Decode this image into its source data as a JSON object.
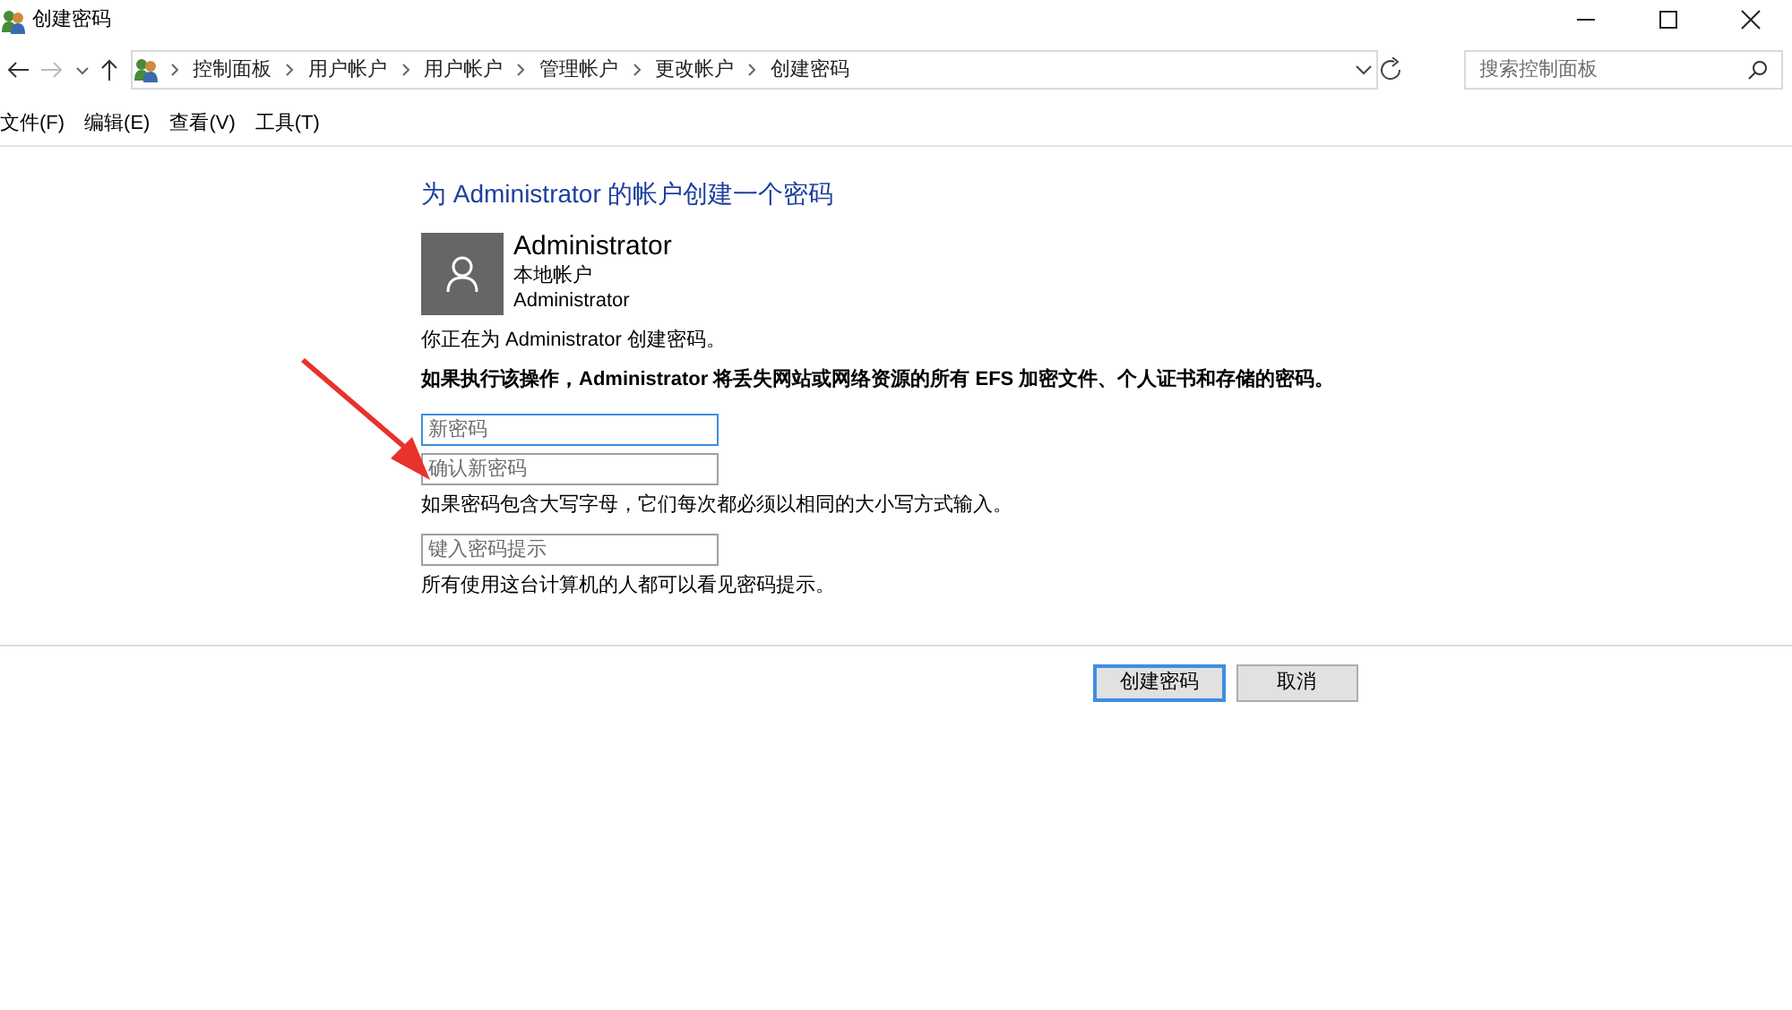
{
  "window": {
    "title": "创建密码"
  },
  "breadcrumbs": [
    "控制面板",
    "用户帐户",
    "用户帐户",
    "管理帐户",
    "更改帐户",
    "创建密码"
  ],
  "search": {
    "placeholder": "搜索控制面板"
  },
  "menu": [
    "文件(F)",
    "编辑(E)",
    "查看(V)",
    "工具(T)"
  ],
  "heading": "为 Administrator 的帐户创建一个密码",
  "account": {
    "name": "Administrator",
    "type": "本地帐户",
    "username": "Administrator"
  },
  "info": "你正在为 Administrator 创建密码。",
  "warning": "如果执行该操作，Administrator 将丢失网站或网络资源的所有 EFS 加密文件、个人证书和存储的密码。",
  "fields": [
    {
      "placeholder": "新密码",
      "focused": true
    },
    {
      "placeholder": "确认新密码",
      "focused": false,
      "note": "如果密码包含大写字母，它们每次都必须以相同的大小写方式输入。"
    },
    {
      "placeholder": "键入密码提示",
      "focused": false,
      "note": "所有使用这台计算机的人都可以看见密码提示。"
    }
  ],
  "buttons": [
    {
      "label": "创建密码",
      "default": true
    },
    {
      "label": "取消",
      "default": false
    }
  ]
}
